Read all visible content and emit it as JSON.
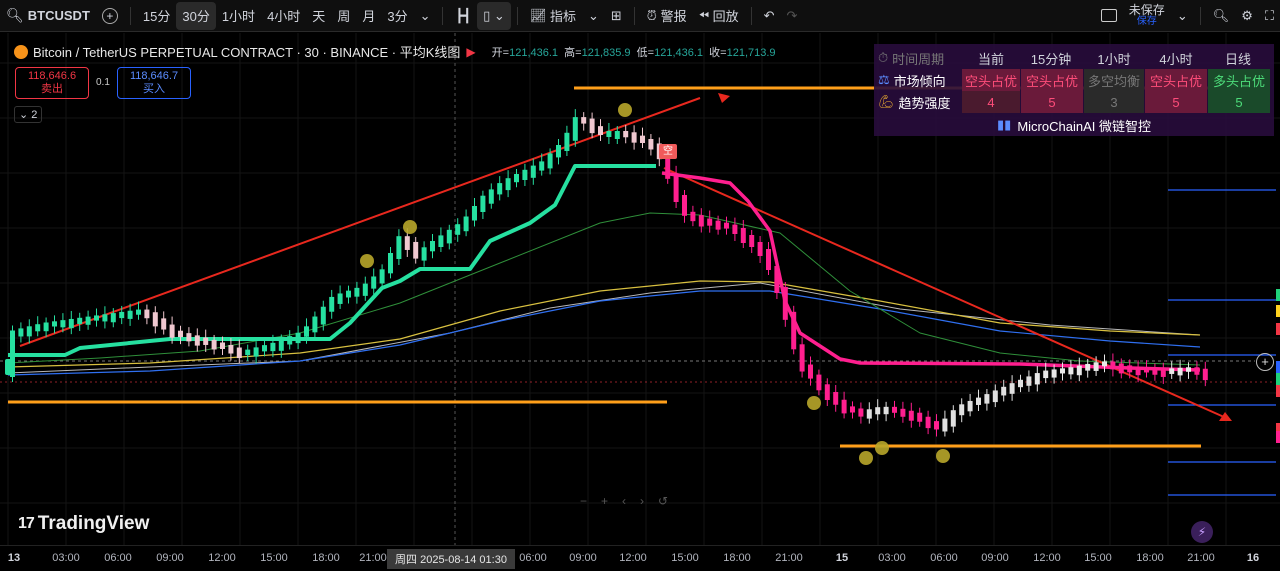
{
  "toolbar": {
    "symbol": "BTCUSDT",
    "intervals": [
      "15分",
      "30分",
      "1小时",
      "4小时",
      "天",
      "周",
      "月",
      "3分"
    ],
    "active_interval": "30分",
    "indicators_label": "指标",
    "alert_label": "警报",
    "replay_label": "回放",
    "save_label": "未保存",
    "save_sub": "保存",
    "icons": [
      "search-icon",
      "add-symbol-icon",
      "chevron-down-icon",
      "bar-style-icon",
      "candle-style-icon",
      "indicators-icon",
      "templates-icon",
      "alert-icon",
      "replay-icon",
      "undo-icon",
      "redo-icon",
      "layout-icon",
      "quick-search-icon",
      "settings-icon",
      "fullscreen-icon"
    ]
  },
  "legend": {
    "title": "Bitcoin / TetherUS PERPETUAL CONTRACT · 30 · BINANCE · 平均K线图",
    "flag": "▶",
    "open_label": "开=",
    "open": "121,436.1",
    "high_label": "高=",
    "high": "121,835.9",
    "low_label": "低=",
    "low": "121,436.1",
    "close_label": "收=",
    "close": "121,713.9"
  },
  "prices": {
    "sell": "118,646.6",
    "sell_label": "卖出",
    "buy": "118,646.7",
    "buy_label": "买入",
    "spread": "0.1"
  },
  "collapse_label": "2",
  "indicator_table": {
    "header": [
      "时间周期",
      "当前",
      "15分钟",
      "1小时",
      "4小时",
      "日线"
    ],
    "rows": [
      {
        "label": "市场倾向",
        "icon": "scales-icon",
        "values": [
          "空头占优",
          "空头占优",
          "多空均衡",
          "空头占优",
          "多头占优"
        ]
      },
      {
        "label": "趋势强度",
        "icon": "strength-icon",
        "values": [
          "4",
          "5",
          "3",
          "5",
          "5"
        ]
      }
    ],
    "footer": "MicroChainAI 微链智控"
  },
  "signal_tag": "空",
  "watermark": "TradingView",
  "colors": {
    "up": "#26e0a0",
    "down": "#f23645",
    "magenta": "#ff1f8f",
    "orange": "#ff9f1a",
    "trend_red": "#e8281e",
    "ma_green": "#2f8f3a",
    "ma_yellow": "#d8c040",
    "ma_blue": "#2f6ff0",
    "ma_gray": "#b8b8b8"
  },
  "time_axis": {
    "ticks": [
      "13",
      "03:00",
      "06:00",
      "09:00",
      "12:00",
      "15:00",
      "18:00",
      "21:00",
      "06:00",
      "09:00",
      "12:00",
      "15:00",
      "18:00",
      "21:00",
      "15",
      "03:00",
      "06:00",
      "09:00",
      "12:00",
      "15:00",
      "18:00",
      "21:00",
      "16"
    ],
    "bold_ticks": [
      "13",
      "15",
      "16"
    ],
    "cursor_label": "周四 2025-08-14  01:30"
  }
}
